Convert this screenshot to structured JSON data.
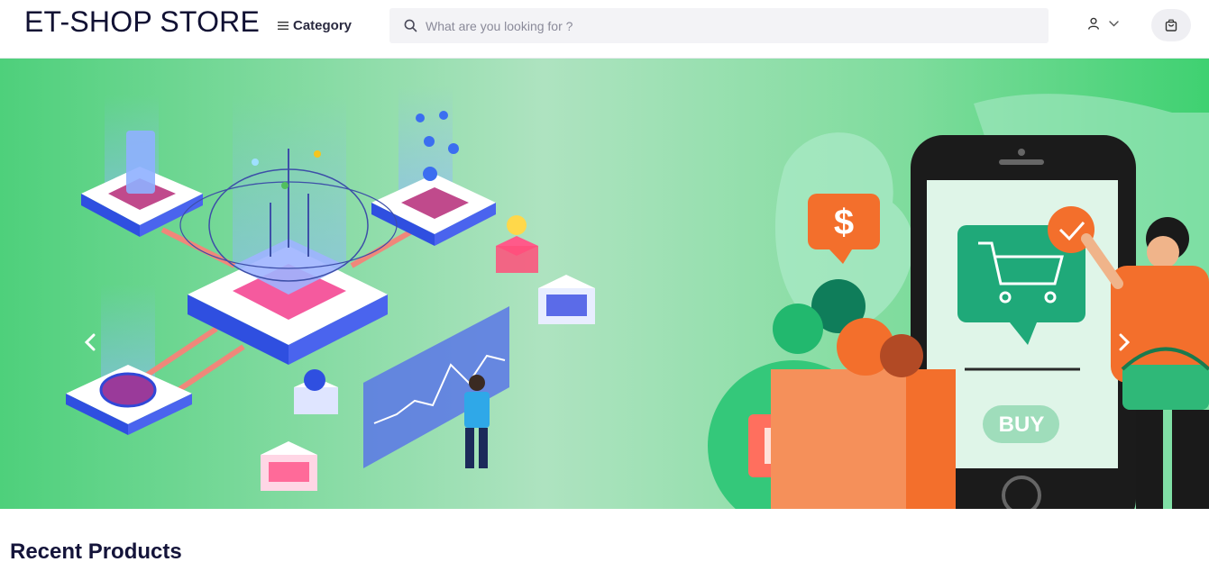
{
  "header": {
    "logo": "ET-SHOP STORE",
    "category_label": "Category",
    "search_placeholder": "What are you looking for ?"
  },
  "icons": {
    "menu": "menu-icon",
    "search": "search-icon",
    "user": "user-icon",
    "chevron": "chevron-down-icon",
    "cart": "shopping-bag-icon",
    "prev": "chevron-left-icon",
    "next": "chevron-right-icon"
  },
  "banner": {
    "button_text": "BUY",
    "currency_symbol": "$"
  },
  "main": {
    "section_title": "Recent Products"
  },
  "colors": {
    "banner_green": "#5fd68a",
    "accent_orange": "#f36f2c",
    "text_dark": "#14143a"
  }
}
